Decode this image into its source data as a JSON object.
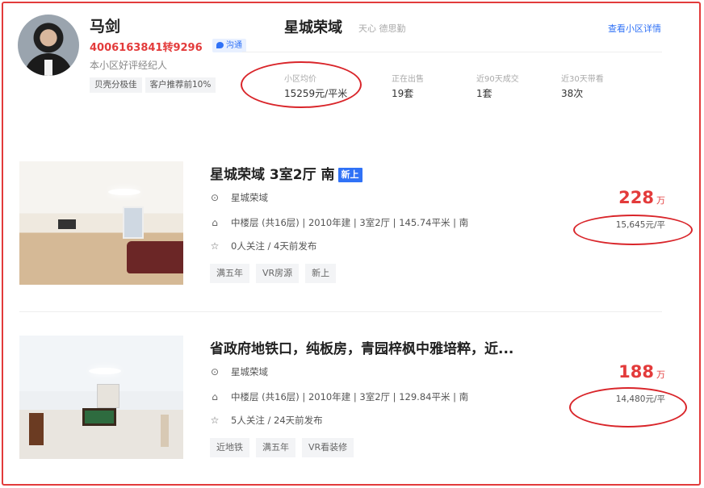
{
  "agent": {
    "name": "马剑",
    "phone": "4006163841转9296",
    "subtitle": "本小区好评经纪人",
    "chat_label": "沟通",
    "tags": [
      "贝壳分极佳",
      "客户推荐前10%"
    ]
  },
  "community": {
    "title": "星城荣域",
    "subtitle": "天心 德思勤",
    "detail_link": "查看小区详情",
    "stats": [
      {
        "label": "小区均价",
        "value": "15259元/平米"
      },
      {
        "label": "正在出售",
        "value": "19套"
      },
      {
        "label": "近90天成交",
        "value": "1套"
      },
      {
        "label": "近30天带看",
        "value": "38次"
      }
    ]
  },
  "listings": [
    {
      "title": "星城荣域 3室2厅 南",
      "badge": "新上",
      "location": "星城荣域",
      "details": "中楼层 (共16层) | 2010年建 | 3室2厅 | 145.74平米 | 南",
      "follow": "0人关注 / 4天前发布",
      "tags": [
        "满五年",
        "VR房源",
        "新上"
      ],
      "price": "228",
      "price_unit": "万",
      "unit_price": "15,645元/平"
    },
    {
      "title": "省政府地铁口，纯板房，青园梓枫中雅培粹，近...",
      "badge": "",
      "location": "星城荣域",
      "details": "中楼层 (共16层) | 2010年建 | 3室2厅 | 129.84平米 | 南",
      "follow": "5人关注 / 24天前发布",
      "tags": [
        "近地铁",
        "满五年",
        "VR看装修"
      ],
      "price": "188",
      "price_unit": "万",
      "unit_price": "14,480元/平"
    }
  ],
  "icons": {
    "location": "location-pin-icon",
    "house": "house-icon",
    "star": "star-icon",
    "chat": "chat-bubble-icon"
  },
  "colors": {
    "accent_red": "#e33b3b",
    "link_blue": "#3072f6",
    "annotation_red": "#d9252a"
  }
}
